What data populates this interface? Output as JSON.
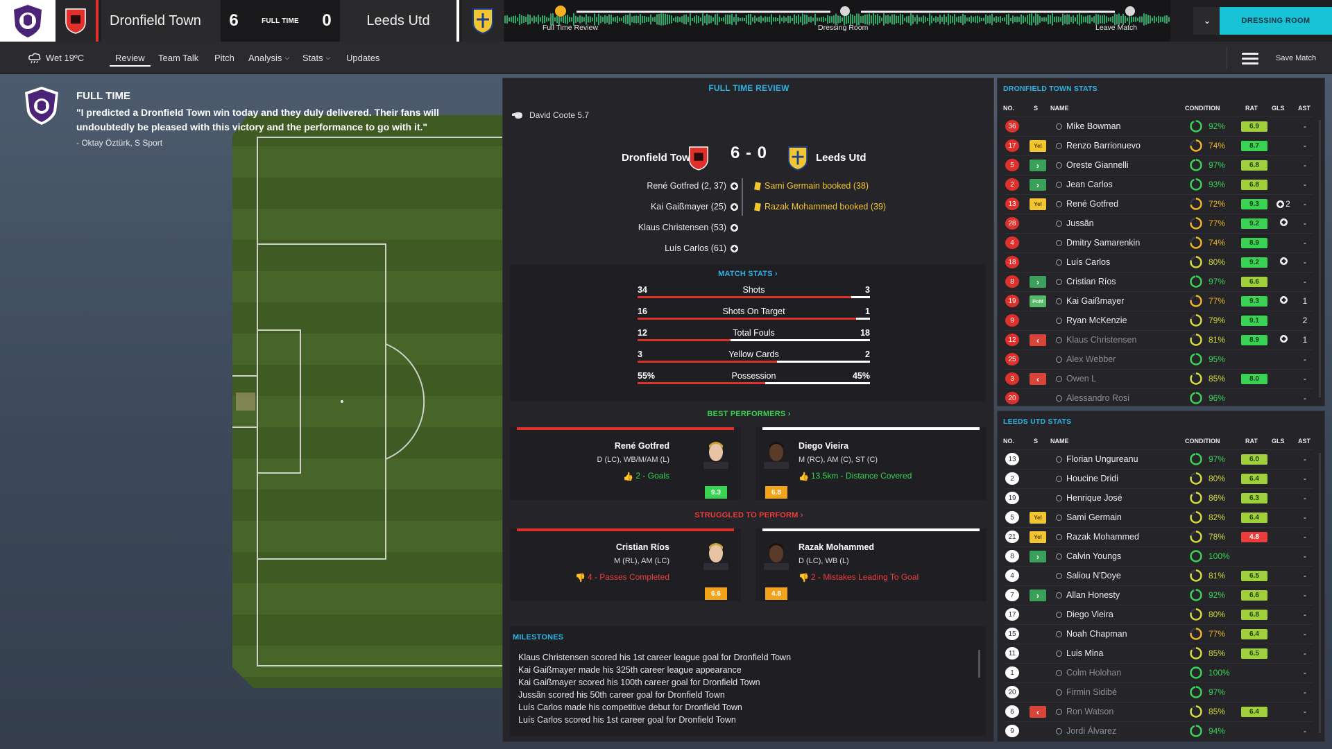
{
  "header": {
    "home_team": "Dronfield Town",
    "home_score": "6",
    "status": "FULL TIME",
    "away_score": "0",
    "away_team": "Leeds Utd",
    "timeline": [
      "Full Time Review",
      "Dressing Room",
      "Leave Match"
    ],
    "dressing_room_button": "DRESSING ROOM",
    "colors": {
      "home": "#e0302b",
      "away": "#ffffff",
      "accent": "#19c3d6"
    }
  },
  "subnav": {
    "weather": "Wet 19ºC",
    "tabs": [
      "Review",
      "Team Talk",
      "Pitch",
      "Analysis",
      "Stats",
      "Updates"
    ],
    "active_tab": "Review",
    "save_match": "Save Match"
  },
  "fulltime": {
    "title": "FULL TIME",
    "quote": "\"I predicted a Dronfield Town win today and they duly delivered. Their fans will undoubtedly be pleased with this victory and the performance to go with it.\"",
    "source": "- Oktay Öztürk, S Sport"
  },
  "review": {
    "title": "FULL TIME REVIEW",
    "referee": "David Coote 5.7",
    "home_team": "Dronfield Town",
    "away_team": "Leeds Utd",
    "score": "6 - 0",
    "home_events": [
      "René Gotfred (2, 37)",
      "Kai Gaißmayer (25)",
      "Klaus Christensen (53)",
      "Luís Carlos (61)"
    ],
    "away_events": [
      "Sami Germain booked (38)",
      "Razak Mohammed booked (39)"
    ],
    "match_stats_title": "MATCH STATS",
    "match_stats": [
      {
        "label": "Shots",
        "home": "34",
        "away": "3",
        "home_frac": 0.92
      },
      {
        "label": "Shots On Target",
        "home": "16",
        "away": "1",
        "home_frac": 0.94
      },
      {
        "label": "Total Fouls",
        "home": "12",
        "away": "18",
        "home_frac": 0.4
      },
      {
        "label": "Yellow Cards",
        "home": "3",
        "away": "2",
        "home_frac": 0.6
      },
      {
        "label": "Possession",
        "home": "55%",
        "away": "45%",
        "home_frac": 0.55
      }
    ],
    "best_title": "BEST PERFORMERS",
    "best": [
      {
        "name": "René Gotfred",
        "pos": "D (LC), WB/M/AM (L)",
        "stat": "2 - Goals",
        "rating": "9.3"
      },
      {
        "name": "Diego Vieira",
        "pos": "M (RC), AM (C), ST (C)",
        "stat": "13.5km - Distance Covered",
        "rating": "6.8"
      }
    ],
    "struggled_title": "STRUGGLED TO PERFORM",
    "struggled": [
      {
        "name": "Cristian Ríos",
        "pos": "M (RL), AM (LC)",
        "stat": "4 - Passes Completed",
        "rating": "6.6"
      },
      {
        "name": "Razak Mohammed",
        "pos": "D (LC), WB (L)",
        "stat": "2 - Mistakes Leading To Goal",
        "rating": "4.8"
      }
    ],
    "milestones_title": "MILESTONES",
    "milestones": [
      "Klaus Christensen scored his 1st career league goal for Dronfield Town",
      "Kai Gaißmayer made his 325th career league appearance",
      "Kai Gaißmayer scored his 100th career goal for Dronfield Town",
      "Jussãn scored his 50th career goal for Dronfield Town",
      "Luís Carlos made his competitive debut for Dronfield Town",
      "Luís Carlos scored his 1st career goal for Dronfield Town"
    ]
  },
  "columns": {
    "no": "NO.",
    "s": "S",
    "name": "NAME",
    "condition": "CONDITION",
    "rat": "RAT",
    "gls": "GLS",
    "ast": "AST"
  },
  "home_stats": {
    "title": "DRONFIELD TOWN STATS",
    "players": [
      {
        "no": "36",
        "s": "",
        "name": "Mike Bowman",
        "cond": "92%",
        "cond_frac": 0.92,
        "rat": "6.9",
        "rat_c": "lime",
        "gls": "",
        "ast": "-"
      },
      {
        "no": "17",
        "s": "Yel",
        "name": "Renzo Barrionuevo",
        "cond": "74%",
        "cond_frac": 0.74,
        "rat": "8.7",
        "rat_c": "green",
        "gls": "",
        "ast": "-"
      },
      {
        "no": "5",
        "s": "in",
        "name": "Oreste Giannelli",
        "cond": "97%",
        "cond_frac": 0.97,
        "rat": "6.8",
        "rat_c": "lime",
        "gls": "",
        "ast": "-"
      },
      {
        "no": "2",
        "s": "in",
        "name": "Jean Carlos",
        "cond": "93%",
        "cond_frac": 0.93,
        "rat": "6.8",
        "rat_c": "lime",
        "gls": "",
        "ast": "-"
      },
      {
        "no": "13",
        "s": "Yel",
        "name": "René Gotfred",
        "cond": "72%",
        "cond_frac": 0.72,
        "rat": "9.3",
        "rat_c": "green",
        "gls": "2",
        "ast": "-"
      },
      {
        "no": "28",
        "s": "",
        "name": "Jussãn",
        "cond": "77%",
        "cond_frac": 0.77,
        "rat": "9.2",
        "rat_c": "green",
        "gls": "1",
        "ast": "-"
      },
      {
        "no": "4",
        "s": "",
        "name": "Dmitry Samarenkin",
        "cond": "74%",
        "cond_frac": 0.74,
        "rat": "8.9",
        "rat_c": "green",
        "gls": "",
        "ast": "-"
      },
      {
        "no": "18",
        "s": "",
        "name": "Luís Carlos",
        "cond": "80%",
        "cond_frac": 0.8,
        "rat": "9.2",
        "rat_c": "green",
        "gls": "1",
        "ast": "-"
      },
      {
        "no": "8",
        "s": "in",
        "name": "Cristian Ríos",
        "cond": "97%",
        "cond_frac": 0.97,
        "rat": "6.6",
        "rat_c": "lime",
        "gls": "",
        "ast": "-"
      },
      {
        "no": "19",
        "s": "PoM",
        "name": "Kai Gaißmayer",
        "cond": "77%",
        "cond_frac": 0.77,
        "rat": "9.3",
        "rat_c": "green",
        "gls": "1",
        "ast": "1"
      },
      {
        "no": "9",
        "s": "",
        "name": "Ryan McKenzie",
        "cond": "79%",
        "cond_frac": 0.79,
        "rat": "9.1",
        "rat_c": "green",
        "gls": "",
        "ast": "2"
      },
      {
        "no": "12",
        "s": "out",
        "name": "Klaus Christensen",
        "cond": "81%",
        "cond_frac": 0.81,
        "rat": "8.9",
        "rat_c": "green",
        "gls": "1",
        "ast": "1",
        "dim": true
      },
      {
        "no": "25",
        "s": "",
        "name": "Alex Webber",
        "cond": "95%",
        "cond_frac": 0.95,
        "rat": "",
        "rat_c": "",
        "gls": "",
        "ast": "-",
        "dim": true
      },
      {
        "no": "3",
        "s": "out",
        "name": "Owen L",
        "cond": "85%",
        "cond_frac": 0.85,
        "rat": "8.0",
        "rat_c": "green",
        "gls": "",
        "ast": "-",
        "dim": true
      },
      {
        "no": "20",
        "s": "",
        "name": "Alessandro Rosi",
        "cond": "96%",
        "cond_frac": 0.96,
        "rat": "",
        "rat_c": "",
        "gls": "",
        "ast": "-",
        "dim": true
      }
    ]
  },
  "away_stats": {
    "title": "LEEDS UTD STATS",
    "players": [
      {
        "no": "13",
        "s": "",
        "name": "Florian Ungureanu",
        "cond": "97%",
        "cond_frac": 0.97,
        "rat": "6.0",
        "rat_c": "lime",
        "gls": "",
        "ast": "-"
      },
      {
        "no": "2",
        "s": "",
        "name": "Houcine Dridi",
        "cond": "80%",
        "cond_frac": 0.8,
        "rat": "6.4",
        "rat_c": "lime",
        "gls": "",
        "ast": "-"
      },
      {
        "no": "19",
        "s": "",
        "name": "Henrique José",
        "cond": "86%",
        "cond_frac": 0.86,
        "rat": "6.3",
        "rat_c": "lime",
        "gls": "",
        "ast": "-"
      },
      {
        "no": "5",
        "s": "Yel",
        "name": "Sami Germain",
        "cond": "82%",
        "cond_frac": 0.82,
        "rat": "6.4",
        "rat_c": "lime",
        "gls": "",
        "ast": "-"
      },
      {
        "no": "21",
        "s": "Yel",
        "name": "Razak Mohammed",
        "cond": "78%",
        "cond_frac": 0.78,
        "rat": "4.8",
        "rat_c": "red",
        "gls": "",
        "ast": "-"
      },
      {
        "no": "8",
        "s": "in",
        "name": "Calvin Youngs",
        "cond": "100%",
        "cond_frac": 1.0,
        "rat": "",
        "rat_c": "",
        "gls": "",
        "ast": "-"
      },
      {
        "no": "4",
        "s": "",
        "name": "Saliou N'Doye",
        "cond": "81%",
        "cond_frac": 0.81,
        "rat": "6.5",
        "rat_c": "lime",
        "gls": "",
        "ast": "-"
      },
      {
        "no": "7",
        "s": "in",
        "name": "Allan Honesty",
        "cond": "92%",
        "cond_frac": 0.92,
        "rat": "6.6",
        "rat_c": "lime",
        "gls": "",
        "ast": "-"
      },
      {
        "no": "17",
        "s": "",
        "name": "Diego Vieira",
        "cond": "80%",
        "cond_frac": 0.8,
        "rat": "6.8",
        "rat_c": "lime",
        "gls": "",
        "ast": "-"
      },
      {
        "no": "15",
        "s": "",
        "name": "Noah Chapman",
        "cond": "77%",
        "cond_frac": 0.77,
        "rat": "6.4",
        "rat_c": "lime",
        "gls": "",
        "ast": "-"
      },
      {
        "no": "11",
        "s": "",
        "name": "Luis Mina",
        "cond": "85%",
        "cond_frac": 0.85,
        "rat": "6.5",
        "rat_c": "lime",
        "gls": "",
        "ast": "-"
      },
      {
        "no": "1",
        "s": "",
        "name": "Colm Holohan",
        "cond": "100%",
        "cond_frac": 1.0,
        "rat": "",
        "rat_c": "",
        "gls": "",
        "ast": "-",
        "dim": true
      },
      {
        "no": "20",
        "s": "",
        "name": "Firmin Sidibé",
        "cond": "97%",
        "cond_frac": 0.97,
        "rat": "",
        "rat_c": "",
        "gls": "",
        "ast": "-",
        "dim": true
      },
      {
        "no": "6",
        "s": "out",
        "name": "Ron Watson",
        "cond": "85%",
        "cond_frac": 0.85,
        "rat": "6.4",
        "rat_c": "lime",
        "gls": "",
        "ast": "-",
        "dim": true
      },
      {
        "no": "9",
        "s": "",
        "name": "Jordi Álvarez",
        "cond": "94%",
        "cond_frac": 0.94,
        "rat": "",
        "rat_c": "",
        "gls": "",
        "ast": "-",
        "dim": true
      }
    ]
  }
}
